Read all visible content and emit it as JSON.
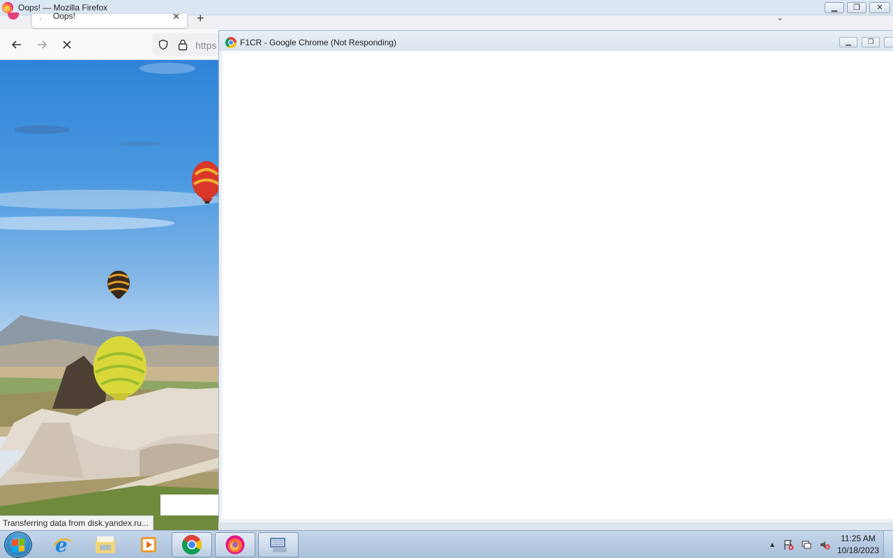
{
  "firefox": {
    "window_title": "Oops! — Mozilla Firefox",
    "tab_label": "Oops!",
    "url_partial": "https",
    "status_text": "Transferring data from disk.yandex.ru..."
  },
  "chrome": {
    "window_title": "F1CR - Google Chrome (Not Responding)"
  },
  "taskbar": {
    "items": [
      "Start",
      "Internet Explorer",
      "Windows Explorer",
      "Media Player",
      "Google Chrome",
      "Mozilla Firefox",
      "On-Screen Keyboard"
    ],
    "clock_time": "11:25 AM",
    "clock_date": "10/18/2023"
  },
  "colors": {
    "firefox_titlebar": "#dbe6f3",
    "taskbar": "#b7cce3",
    "sky": "#3a8bd9"
  }
}
